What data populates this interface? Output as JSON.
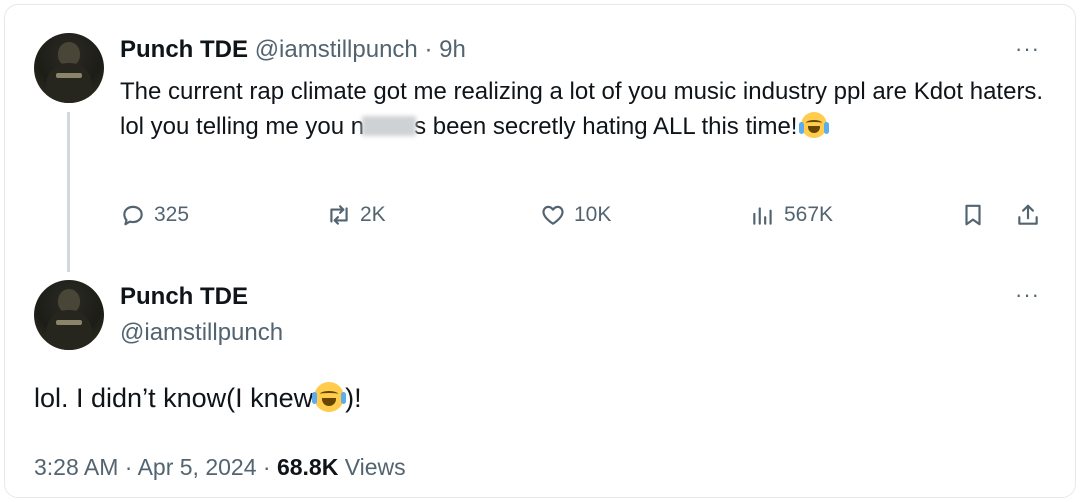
{
  "tweet1": {
    "display_name": "Punch TDE",
    "handle": "@iamstillpunch",
    "separator": "·",
    "time_ago": "9h",
    "text_part1": "The current rap climate got me realizing a lot of you music industry ppl are Kdot haters. lol you telling me you n",
    "text_part2": "s been secretly hating ALL this time!",
    "emoji": "face-with-tears-of-joy",
    "more_label": "···",
    "actions": {
      "reply_count": "325",
      "retweet_count": "2K",
      "like_count": "10K",
      "views_count": "567K"
    }
  },
  "tweet2": {
    "display_name": "Punch TDE",
    "handle": "@iamstillpunch",
    "more_label": "···",
    "text_part1": "lol. I didn’t know(I knew",
    "text_part2": ")!",
    "emoji": "face-with-tears-of-joy",
    "time": "3:28 AM",
    "separator": "·",
    "date": "Apr 5, 2024",
    "views_count": "68.8K",
    "views_label": "Views"
  },
  "colors": {
    "text": "#0f1419",
    "muted": "#536471",
    "thread_line": "#cfd9de",
    "border": "#e6e8ea"
  }
}
